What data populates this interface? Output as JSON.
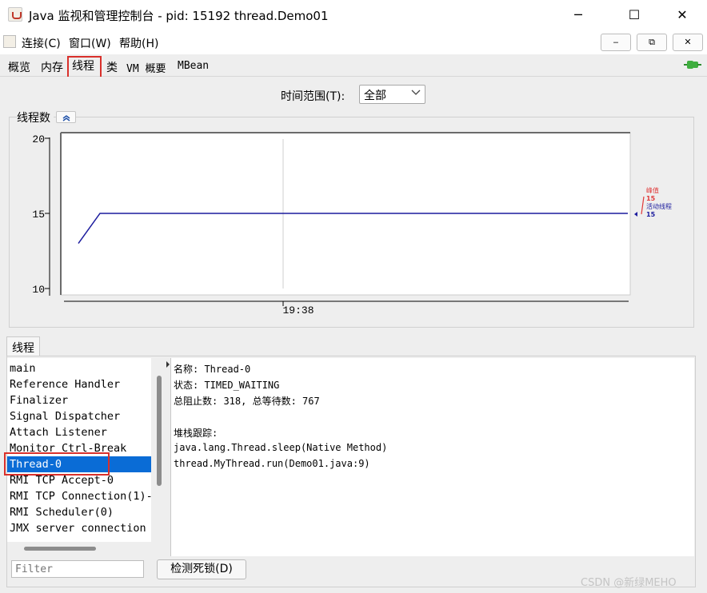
{
  "window": {
    "title": "Java 监视和管理控制台 - pid: 15192 thread.Demo01",
    "minimize": "─",
    "maximize": "☐",
    "close": "✕"
  },
  "menu": {
    "items": [
      "连接(C)",
      "窗口(W)",
      "帮助(H)"
    ],
    "mdi_buttons": [
      "‒",
      "⧉",
      "✕"
    ]
  },
  "tabs": [
    "概览",
    "内存",
    "线程",
    "类",
    "VM 概要",
    "MBean"
  ],
  "active_tab": "线程",
  "time_range": {
    "label": "时间范围(T):",
    "value": "全部"
  },
  "chart_data": {
    "type": "line",
    "title": "线程数",
    "ylim": [
      10,
      20
    ],
    "yticks": [
      10,
      15,
      20
    ],
    "xticks": [
      "19:38"
    ],
    "series": [
      {
        "name": "峰值",
        "color": "#e03a3a",
        "current": 15
      },
      {
        "name": "活动线程",
        "color": "#1c1c9e",
        "current": 15,
        "values": [
          13,
          15,
          15
        ]
      }
    ]
  },
  "threads_panel": {
    "tab_label": "线程",
    "threads": [
      "main",
      "Reference Handler",
      "Finalizer",
      "Signal Dispatcher",
      "Attach Listener",
      "Monitor Ctrl-Break",
      "Thread-0",
      "RMI TCP Accept-0",
      "RMI TCP Connection(1)-",
      "RMI Scheduler(0)",
      "JMX server connection"
    ],
    "selected": "Thread-0",
    "details": {
      "name_line": "名称: Thread-0",
      "state_line": "状态: TIMED_WAITING",
      "counts_line": "总阻止数: 318, 总等待数: 767",
      "stack_title": "堆栈跟踪:",
      "stack": [
        "java.lang.Thread.sleep(Native Method)",
        "thread.MyThread.run(Demo01.java:9)"
      ]
    },
    "filter_placeholder": "Filter",
    "deadlock_button": "检测死锁(D)"
  },
  "watermark": "CSDN @新绿MEHO",
  "colors": {
    "selection": "#0a6cd6",
    "highlight_box": "#d9302b",
    "peak": "#e03a3a",
    "live": "#1c1c9e"
  }
}
